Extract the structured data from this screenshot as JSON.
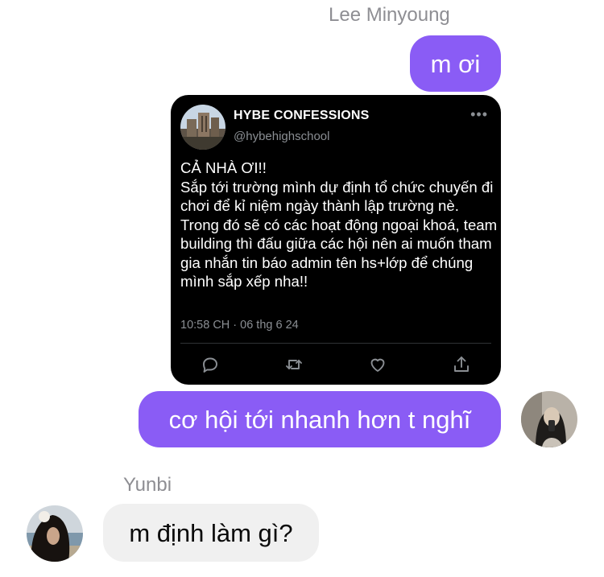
{
  "conversation": {
    "sender_top": "Lee Minyoung",
    "sender_bottom": "Yunbi",
    "messages": {
      "m1": "m ơi",
      "m2": "cơ hội tới nhanh hơn t nghĩ",
      "m3": "m định làm gì?"
    },
    "colors": {
      "outgoing_bubble": "#8a5cf5",
      "incoming_bubble": "#f0f0f0",
      "name_text": "#8e8e93"
    }
  },
  "tweet": {
    "name": "HYBE CONFESSIONS",
    "handle": "@hybehighschool",
    "more": "•••",
    "text": "CẢ NHÀ ƠI!!\nSắp tới trường mình dự định tổ chức chuyến đi chơi để kỉ niệm ngày thành lập trường nè. Trong đó sẽ có các hoạt động ngoại khoá, team building thì đấu giữa các hội nên ai muốn tham gia nhắn tin báo admin tên hs+lớp để chúng mình sắp xếp nha!!",
    "time": "10:58 CH · 06 thg 6 24",
    "actions": [
      "reply-icon",
      "retweet-icon",
      "like-icon",
      "share-icon"
    ]
  }
}
